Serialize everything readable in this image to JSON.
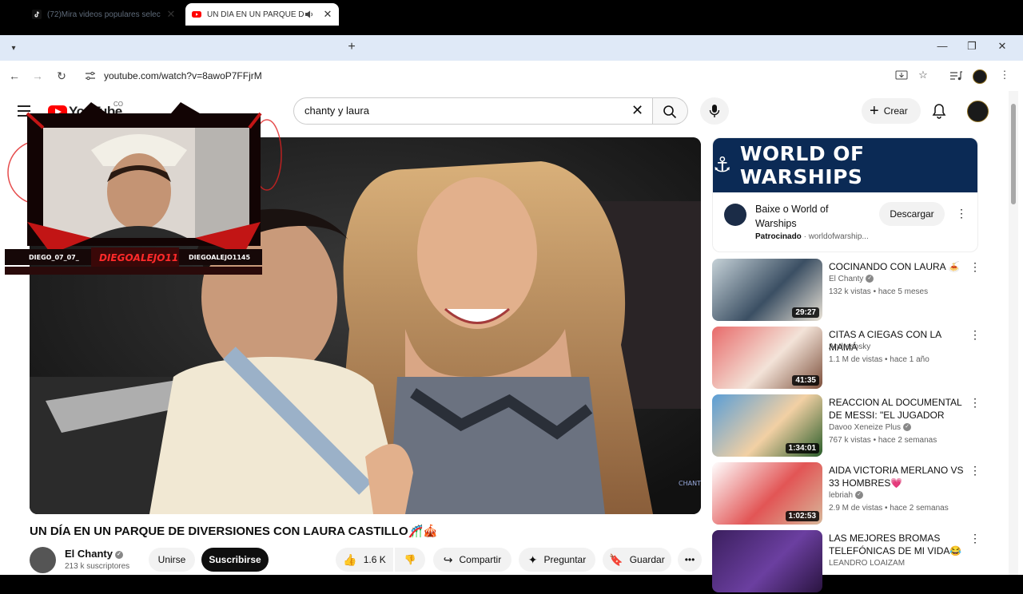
{
  "browser": {
    "tabs": [
      {
        "title": "(72)Mira videos populares selec",
        "close": "✕"
      },
      {
        "title": "UN DÍA EN UN PARQUE DE",
        "close": "✕"
      }
    ],
    "url": "youtube.com/watch?v=8awoP7FFjrM",
    "new_tab": "+",
    "window_controls": [
      "—",
      "❐",
      "✕"
    ]
  },
  "header": {
    "logo_text": "YouTube",
    "logo_suffix": "CO",
    "search_value": "chanty y laura",
    "create_label": "Crear"
  },
  "stream_overlay": {
    "left_handle": "DIEGO_07_07_",
    "center_name": "DIEGOALEJO11",
    "right_handle": "DIEGOALEJO1145"
  },
  "video": {
    "title": "UN DÍA EN UN PARQUE DE DIVERSIONES CON LAURA CASTILLO🎢🎪",
    "watermark": "CHANTY",
    "channel": "El Chanty",
    "subscribers": "213 k suscriptores",
    "join_label": "Unirse",
    "subscribe_label": "Suscribirse",
    "likes": "1.6 K",
    "share_label": "Compartir",
    "ask_label": "Preguntar",
    "save_label": "Guardar"
  },
  "ad": {
    "banner": "WORLD OF WARSHIPS",
    "title": "Baixe o World of Warships",
    "sponsored": "Patrocinado",
    "domain": "worldofwarship...",
    "button": "Descargar"
  },
  "recommendations": [
    {
      "title": "COCINANDO CON LAURA 🍝",
      "channel": "El Chanty",
      "verified": true,
      "meta": "132 k vistas • hace 5 meses",
      "duration": "29:27",
      "thumb_colors": [
        "#c6d2d8",
        "#3b4f63",
        "#e9e2d6"
      ]
    },
    {
      "title": "CITAS A CIEGAS CON LA MAMÁ",
      "channel": "Andresosky",
      "verified": false,
      "meta": "1.1 M de vistas • hace 1 año",
      "duration": "41:35",
      "thumb_colors": [
        "#e86a6a",
        "#f3e3d8",
        "#7c4f3b"
      ]
    },
    {
      "title": "REACCION AL DOCUMENTAL DE MESSI: \"EL JUGADOR QUE ...",
      "channel": "Davoo Xeneize Plus",
      "verified": true,
      "meta": "767 k vistas • hace 2 semanas",
      "duration": "1:34:01",
      "thumb_colors": [
        "#5a9ed6",
        "#f2d0a4",
        "#2a5d2a"
      ]
    },
    {
      "title": "AIDA VICTORIA MERLANO VS 33 HOMBRES💗",
      "channel": "lebriah",
      "verified": true,
      "meta": "2.9 M de vistas • hace 2 semanas",
      "duration": "1:02:53",
      "thumb_colors": [
        "#ffffff",
        "#e25555",
        "#d8b79a"
      ]
    },
    {
      "title": "LAS MEJORES BROMAS TELEFÓNICAS DE MI VIDA😂",
      "channel": "LEANDRO LOAIZAM",
      "verified": false,
      "meta": "",
      "duration": "",
      "thumb_colors": [
        "#3b1f5e",
        "#6b3fa0",
        "#2a1440"
      ]
    }
  ],
  "colors": {
    "accent_red": "#ff0000",
    "ad_navy": "#0b2a55",
    "text": "#0f0f0f",
    "muted": "#606060"
  }
}
